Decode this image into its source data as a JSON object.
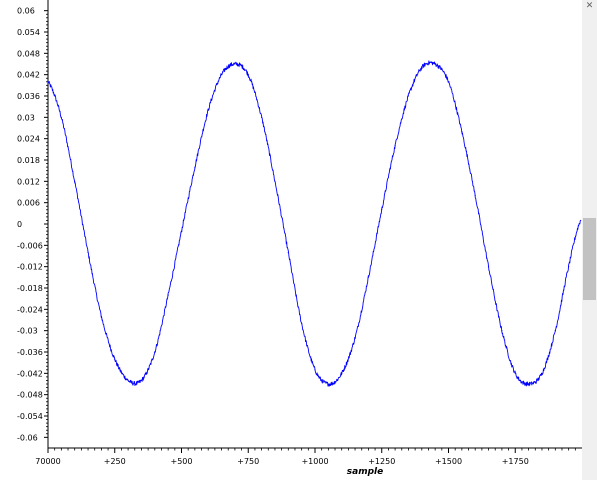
{
  "chart_data": {
    "type": "line",
    "title": "",
    "xlabel": "sample",
    "ylabel": "",
    "xlim": [
      70000,
      72000
    ],
    "ylim": [
      -0.063,
      0.063
    ],
    "x_tick_values": [
      70000,
      70250,
      70500,
      70750,
      71000,
      71250,
      71500,
      71750
    ],
    "x_tick_labels": [
      "70000",
      "+250",
      "+500",
      "+750",
      "+1000",
      "+1250",
      "+1500",
      "+1750"
    ],
    "y_tick_values": [
      0.06,
      0.054,
      0.048,
      0.042,
      0.036,
      0.03,
      0.024,
      0.018,
      0.012,
      0.006,
      0,
      -0.006,
      -0.012,
      -0.018,
      -0.024,
      -0.03,
      -0.036,
      -0.042,
      -0.048,
      -0.054,
      -0.06
    ],
    "y_tick_labels": [
      "0.06",
      "0.054",
      "0.048",
      "0.042",
      "0.036",
      "0.03",
      "0.024",
      "0.018",
      "0.012",
      "0.006",
      "0",
      "-0.006",
      "-0.012",
      "-0.018",
      "-0.024",
      "-0.03",
      "-0.036",
      "-0.042",
      "-0.048",
      "-0.054",
      "-0.06"
    ],
    "grid": false,
    "legend": "none",
    "series": [
      {
        "color": "#0000ff",
        "x": [
          70000,
          70050,
          70100,
          70150,
          70200,
          70250,
          70300,
          70350,
          70400,
          70450,
          70500,
          70550,
          70600,
          70650,
          70700,
          70750,
          70800,
          70850,
          70900,
          70950,
          71000,
          71050,
          71100,
          71150,
          71200,
          71250,
          71300,
          71350,
          71400,
          71450,
          71500,
          71550,
          71600,
          71650,
          71700,
          71750,
          71800,
          71850,
          71900,
          71950,
          71995
        ],
        "y": [
          0.04,
          0.03,
          0.012,
          -0.008,
          -0.026,
          -0.038,
          -0.044,
          -0.044,
          -0.036,
          -0.02,
          -0.002,
          0.016,
          0.032,
          0.042,
          0.045,
          0.042,
          0.03,
          0.012,
          -0.008,
          -0.028,
          -0.041,
          -0.045,
          -0.042,
          -0.032,
          -0.015,
          0.004,
          0.022,
          0.036,
          0.044,
          0.045,
          0.04,
          0.026,
          0.008,
          -0.012,
          -0.03,
          -0.042,
          -0.045,
          -0.042,
          -0.03,
          -0.012,
          0.001
        ]
      }
    ]
  }
}
